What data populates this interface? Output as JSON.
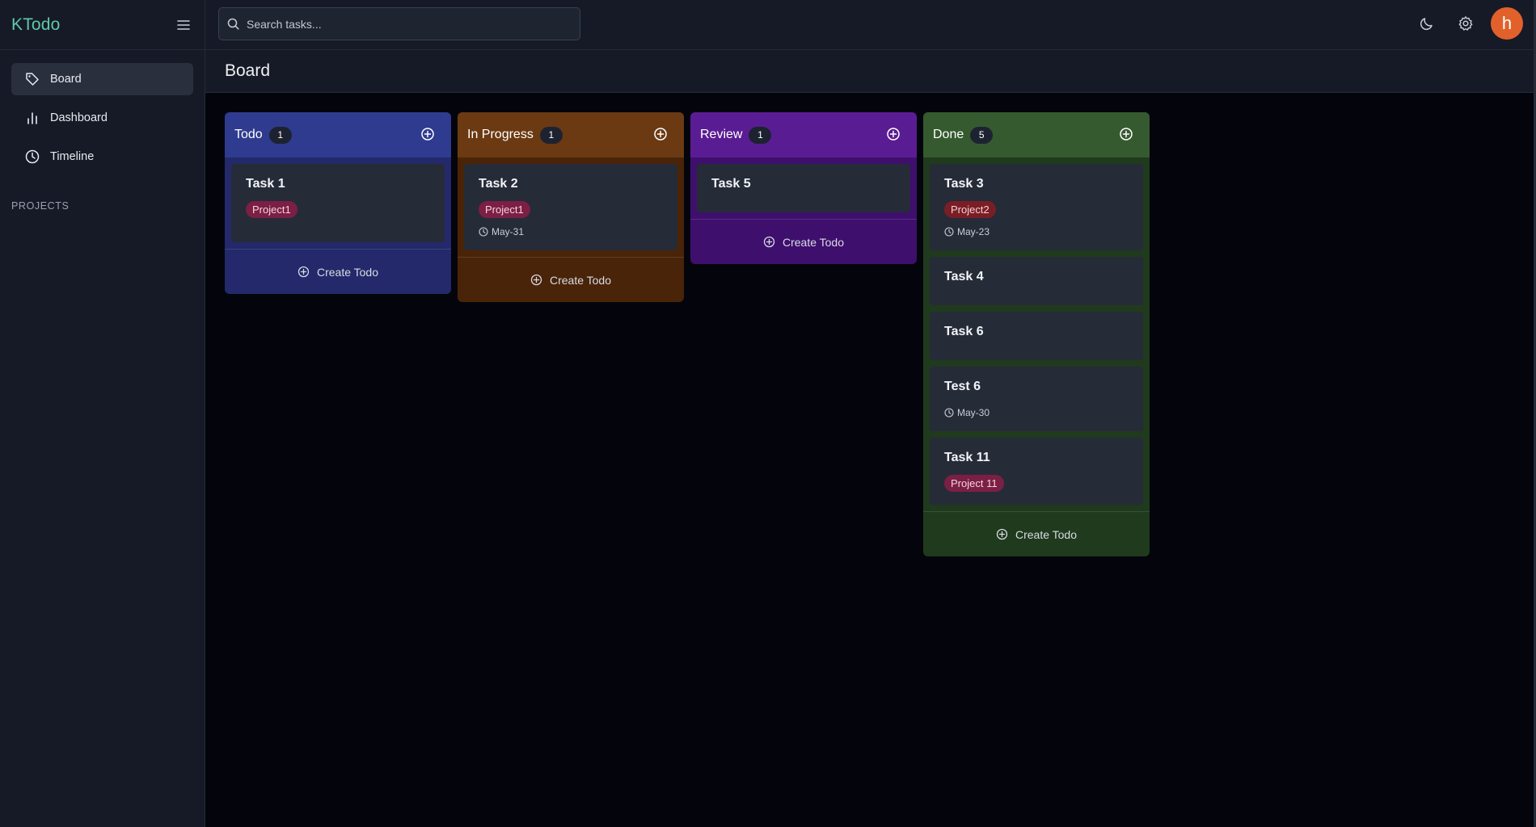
{
  "app": {
    "brand": "KTodo"
  },
  "sidebar": {
    "items": [
      {
        "label": "Board",
        "icon": "tag-icon",
        "active": true
      },
      {
        "label": "Dashboard",
        "icon": "bar-chart-icon",
        "active": false
      },
      {
        "label": "Timeline",
        "icon": "clock-icon",
        "active": false
      }
    ],
    "section_label": "PROJECTS"
  },
  "topbar": {
    "search_placeholder": "Search tasks...",
    "avatar_letter": "h"
  },
  "page": {
    "title": "Board"
  },
  "columns": [
    {
      "title": "Todo",
      "count": "1",
      "color": "#2f3b8f",
      "body_color": "#23296a",
      "create_label": "Create Todo",
      "cards": [
        {
          "title": "Task 1",
          "tag": "Project1",
          "due": ""
        }
      ]
    },
    {
      "title": "In Progress",
      "count": "1",
      "color": "#6b3a12",
      "body_color": "#492408",
      "create_label": "Create Todo",
      "cards": [
        {
          "title": "Task 2",
          "tag": "Project1",
          "due": "May-31"
        }
      ]
    },
    {
      "title": "Review",
      "count": "1",
      "color": "#5a1c93",
      "body_color": "#3f0f6e",
      "create_label": "Create Todo",
      "cards": [
        {
          "title": "Task 5",
          "tag": "",
          "due": ""
        }
      ]
    },
    {
      "title": "Done",
      "count": "5",
      "color": "#355a2f",
      "body_color": "#1f3a1d",
      "create_label": "Create Todo",
      "cards": [
        {
          "title": "Task 3",
          "tag": "Project2",
          "due": "May-23"
        },
        {
          "title": "Task 4",
          "tag": "",
          "due": ""
        },
        {
          "title": "Task 6",
          "tag": "",
          "due": ""
        },
        {
          "title": "Test 6",
          "tag": "",
          "due": "May-30"
        },
        {
          "title": "Task 11",
          "tag": "Project 11",
          "due": ""
        }
      ]
    }
  ]
}
